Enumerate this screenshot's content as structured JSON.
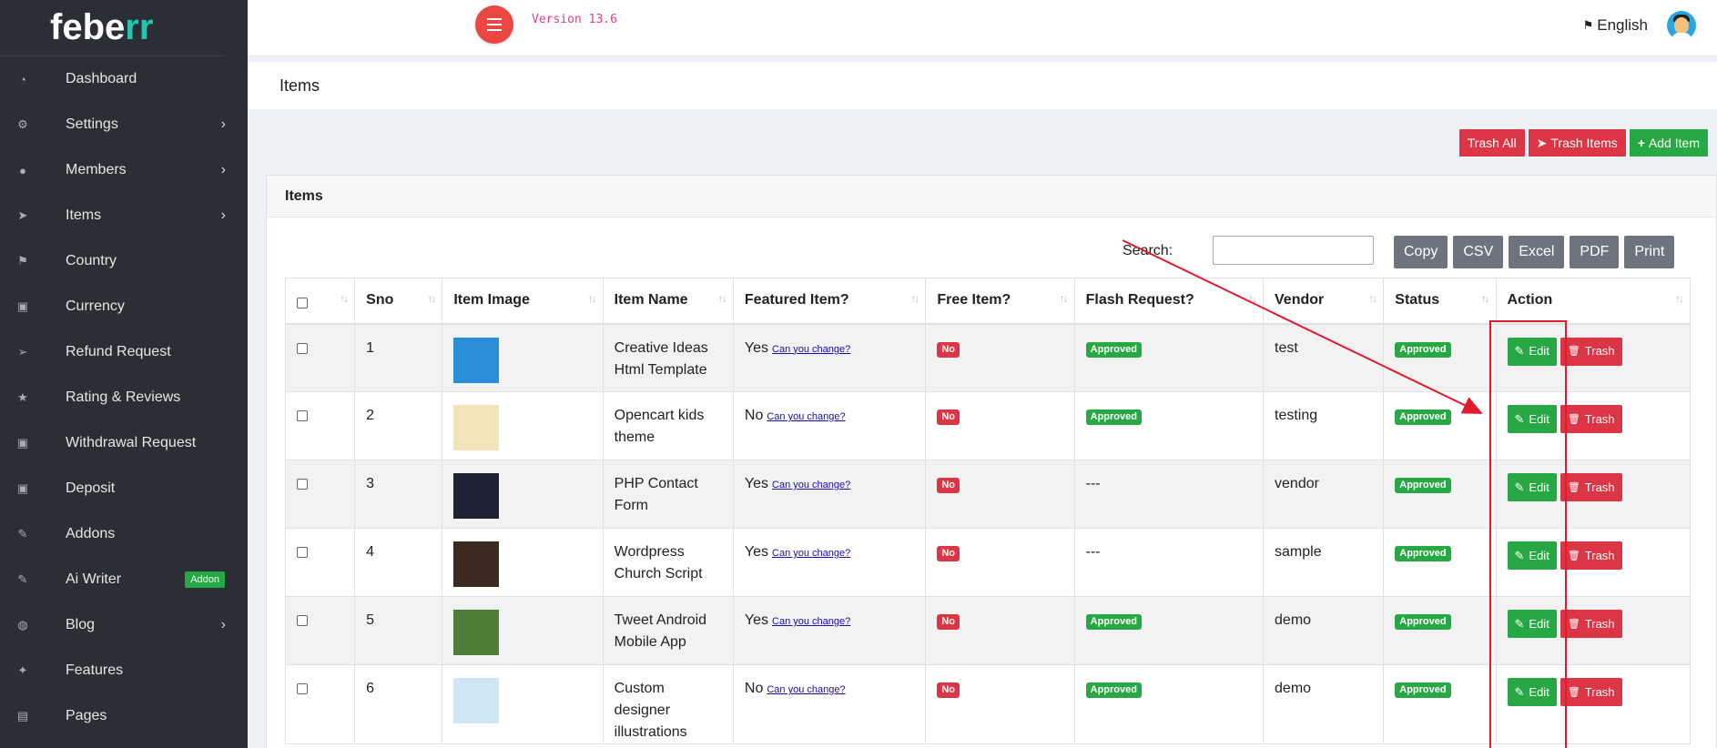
{
  "sidebar": {
    "logo_main": "febe",
    "logo_accent": "rr",
    "items": [
      {
        "label": "Dashboard",
        "icon": "gauge-icon",
        "chevron": ""
      },
      {
        "label": "Settings",
        "icon": "gears-icon",
        "chevron": "›"
      },
      {
        "label": "Members",
        "icon": "users-icon",
        "chevron": "›"
      },
      {
        "label": "Items",
        "icon": "paper-plane-icon",
        "chevron": "›"
      },
      {
        "label": "Country",
        "icon": "flag-icon",
        "chevron": ""
      },
      {
        "label": "Currency",
        "icon": "money-icon",
        "chevron": ""
      },
      {
        "label": "Refund Request",
        "icon": "send-icon",
        "chevron": ""
      },
      {
        "label": "Rating & Reviews",
        "icon": "star-icon",
        "chevron": ""
      },
      {
        "label": "Withdrawal Request",
        "icon": "money-icon",
        "chevron": ""
      },
      {
        "label": "Deposit",
        "icon": "money-icon",
        "chevron": ""
      },
      {
        "label": "Addons",
        "icon": "plug-icon",
        "chevron": ""
      },
      {
        "label": "Ai Writer",
        "icon": "edit-icon",
        "chevron": "",
        "badge": "Addon"
      },
      {
        "label": "Blog",
        "icon": "comments-icon",
        "chevron": "›"
      },
      {
        "label": "Features",
        "icon": "magic-icon",
        "chevron": ""
      },
      {
        "label": "Pages",
        "icon": "file-icon",
        "chevron": ""
      }
    ]
  },
  "topbar": {
    "version": "Version 13.6",
    "language": "English"
  },
  "page": {
    "title": "Items"
  },
  "actions": {
    "trash_all": "Trash All",
    "trash_items": "Trash Items",
    "add_item": "Add Item"
  },
  "card": {
    "title": "Items",
    "search_label": "Search:",
    "export_buttons": [
      "Copy",
      "CSV",
      "Excel",
      "PDF",
      "Print"
    ]
  },
  "table": {
    "columns": [
      "",
      "Sno",
      "Item Image",
      "Item Name",
      "Featured Item?",
      "Free Item?",
      "Flash Request?",
      "Vendor",
      "Status",
      "Action"
    ],
    "change_link": "Can you change?",
    "edit_label": "Edit",
    "trash_label": "Trash",
    "rows": [
      {
        "sno": "1",
        "name": "Creative Ideas Html Template",
        "featured": "Yes",
        "free": "No",
        "flash": "Approved",
        "vendor": "test",
        "status": "Approved",
        "thumb_color": "#2a8fd8"
      },
      {
        "sno": "2",
        "name": "Opencart kids theme",
        "featured": "No",
        "free": "No",
        "flash": "Approved",
        "vendor": "testing",
        "status": "Approved",
        "thumb_color": "#f3e3b8"
      },
      {
        "sno": "3",
        "name": "PHP Contact Form",
        "featured": "Yes",
        "free": "No",
        "flash": "---",
        "vendor": "vendor",
        "status": "Approved",
        "thumb_color": "#1d2333"
      },
      {
        "sno": "4",
        "name": "Wordpress Church Script",
        "featured": "Yes",
        "free": "No",
        "flash": "---",
        "vendor": "sample",
        "status": "Approved",
        "thumb_color": "#3a2a22"
      },
      {
        "sno": "5",
        "name": "Tweet Android Mobile App",
        "featured": "Yes",
        "free": "No",
        "flash": "Approved",
        "vendor": "demo",
        "status": "Approved",
        "thumb_color": "#4e7d3a"
      },
      {
        "sno": "6",
        "name": "Custom designer illustrations",
        "featured": "No",
        "free": "No",
        "flash": "Approved",
        "vendor": "demo",
        "status": "Approved",
        "thumb_color": "#cfe6f4"
      }
    ]
  },
  "colors": {
    "sidebar_bg": "#2b2f35",
    "brand_accent": "#27c3b0",
    "danger": "#dc3545",
    "success": "#28a745",
    "secondary": "#6c757d",
    "annotation": "#e21b2b"
  }
}
